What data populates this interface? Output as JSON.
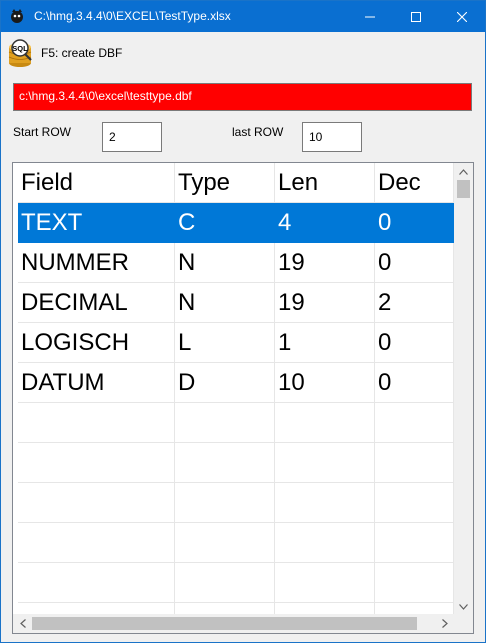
{
  "window": {
    "title": "C:\\hmg.3.4.4\\0\\EXCEL\\TestType.xlsx",
    "title_color": "#0a6fd1"
  },
  "toolbar": {
    "icon": "sql-database-icon",
    "label": "F5: create DBF"
  },
  "path_field": {
    "value": "c:\\hmg.3.4.4\\0\\excel\\testtype.dbf",
    "background": "#ff0000"
  },
  "start_row": {
    "label": "Start ROW",
    "value": "2"
  },
  "last_row": {
    "label": "last ROW",
    "value": "10"
  },
  "grid": {
    "columns": [
      "Field",
      "Type",
      "Len",
      "Dec"
    ],
    "rows": [
      [
        "TEXT",
        "C",
        "4",
        "0"
      ],
      [
        "NUMMER",
        "N",
        "19",
        "0"
      ],
      [
        "DECIMAL",
        "N",
        "19",
        "2"
      ],
      [
        "LOGISCH",
        "L",
        "1",
        "0"
      ],
      [
        "DATUM",
        "D",
        "10",
        "0"
      ]
    ],
    "selected_row": 0,
    "selection_color": "#0078d7",
    "empty_rows": 6
  }
}
